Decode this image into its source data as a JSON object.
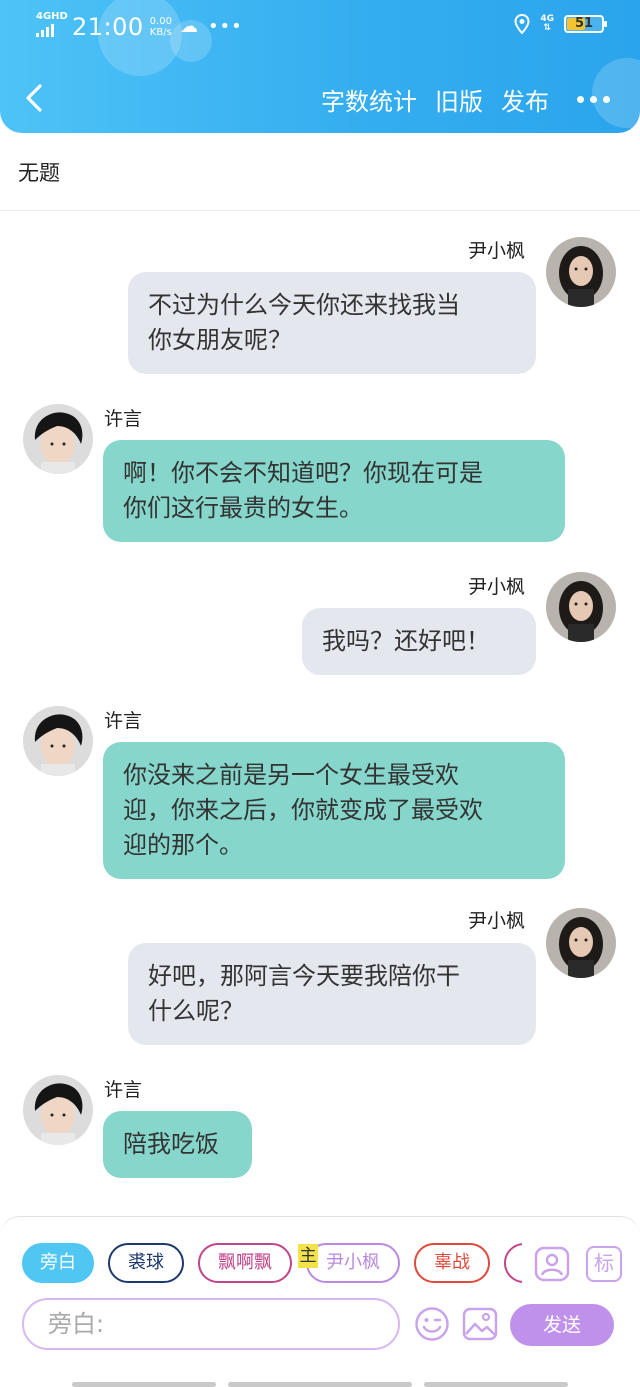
{
  "status_bar": {
    "network": "4GHD",
    "time": "21:00",
    "speed_value": "0.00",
    "speed_unit": "KB/s",
    "right_network": "4G",
    "battery": "51",
    "battery_color": "#f4c430"
  },
  "header": {
    "back_icon": "chevron-left-icon",
    "actions": [
      "字数统计",
      "旧版",
      "发布"
    ],
    "more_icon": "more-dots-icon",
    "gradient_start": "#4ec3f7",
    "gradient_end": "#2aa4ec"
  },
  "page": {
    "title": "无题"
  },
  "messages": [
    {
      "speaker": "尹小枫",
      "side": "right",
      "lines": [
        "不过为什么今天你还来找我当",
        "你女朋友呢？"
      ]
    },
    {
      "speaker": "许言",
      "side": "left",
      "lines": [
        "啊！你不会不知道吧？你现在可是",
        "你们这行最贵的女生。"
      ]
    },
    {
      "speaker": "尹小枫",
      "side": "right",
      "lines": [
        "我吗？还好吧！"
      ]
    },
    {
      "speaker": "许言",
      "side": "left",
      "lines": [
        "你没来之前是另一个女生最受欢",
        "迎，你来之后，你就变成了最受欢",
        "迎的那个。"
      ]
    },
    {
      "speaker": "尹小枫",
      "side": "right",
      "lines": [
        "好吧，那阿言今天要我陪你干",
        "什么呢？"
      ]
    },
    {
      "speaker": "许言",
      "side": "left",
      "lines": [
        "陪我吃饭"
      ]
    }
  ],
  "role_chips": [
    {
      "label": "旁白",
      "color": "#4fc7f2",
      "active": true
    },
    {
      "label": "裘球",
      "color": "#1d3a6e",
      "active": false
    },
    {
      "label": "飘啊飘",
      "color": "#c0458a",
      "active": false
    },
    {
      "label": "尹小枫",
      "color": "#b98ae0",
      "active": false
    },
    {
      "label": "辜战",
      "color": "#e04a3c",
      "active": false
    }
  ],
  "main_badge": "主",
  "tools": {
    "add_role_icon": "person-card-icon",
    "tag_icon": "tag-label-icon",
    "tag_label": "标",
    "emoji_icon": "emoji-icon",
    "image_icon": "image-icon"
  },
  "composer": {
    "placeholder": "旁白:",
    "send_label": "发送",
    "send_color": "#c091ea"
  },
  "colors": {
    "bubble_right": "#e4e7ee",
    "bubble_left": "#86d6cc"
  }
}
